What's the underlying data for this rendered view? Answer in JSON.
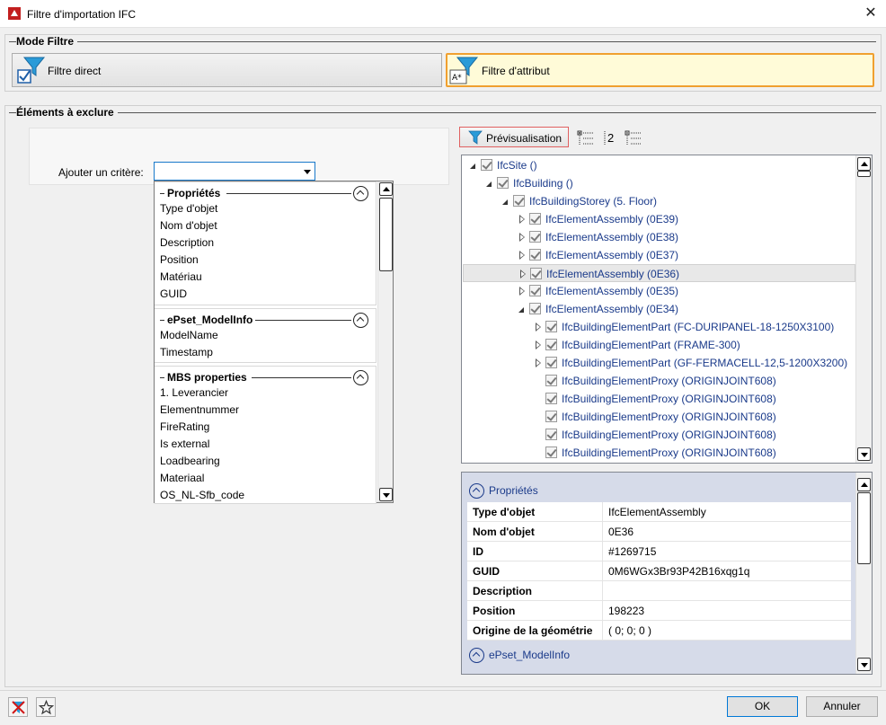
{
  "window": {
    "title": "Filtre d'importation IFC"
  },
  "mode_section": {
    "title": "Mode Filtre",
    "buttons": [
      {
        "label": "Filtre direct",
        "icon": "funnel-checkbox-icon",
        "active": false
      },
      {
        "label": "Filtre d'attribut",
        "icon": "funnel-text-icon",
        "active": true
      }
    ]
  },
  "exclude_section": {
    "title": "Éléments à exclure"
  },
  "criteria": {
    "label": "Ajouter un critère:",
    "value": "",
    "groups": [
      {
        "title": "Propriétés",
        "items": [
          "Type d'objet",
          "Nom d'objet",
          "Description",
          "Position",
          "Matériau",
          "GUID"
        ]
      },
      {
        "title": "ePset_ModelInfo",
        "items": [
          "ModelName",
          "Timestamp"
        ]
      },
      {
        "title": "MBS properties",
        "items": [
          "1. Leverancier",
          "Elementnummer",
          "FireRating",
          "Is external",
          "Loadbearing",
          "Materiaal",
          "OS_NL-Sfb_code"
        ]
      }
    ]
  },
  "toolbar": {
    "preview_label": "Prévisualisation",
    "count_label": "2"
  },
  "tree": {
    "nodes": [
      {
        "label": "IfcSite ()",
        "level": 0,
        "expander": "open",
        "selected": false
      },
      {
        "label": "IfcBuilding ()",
        "level": 1,
        "expander": "open",
        "selected": false
      },
      {
        "label": "IfcBuildingStorey (5. Floor)",
        "level": 2,
        "expander": "open",
        "selected": false
      },
      {
        "label": "IfcElementAssembly (0E39)",
        "level": 3,
        "expander": "closed",
        "selected": false
      },
      {
        "label": "IfcElementAssembly (0E38)",
        "level": 3,
        "expander": "closed",
        "selected": false
      },
      {
        "label": "IfcElementAssembly (0E37)",
        "level": 3,
        "expander": "closed",
        "selected": false
      },
      {
        "label": "IfcElementAssembly (0E36)",
        "level": 3,
        "expander": "closed",
        "selected": true
      },
      {
        "label": "IfcElementAssembly (0E35)",
        "level": 3,
        "expander": "closed",
        "selected": false
      },
      {
        "label": "IfcElementAssembly (0E34)",
        "level": 3,
        "expander": "open",
        "selected": false
      },
      {
        "label": "IfcBuildingElementPart (FC-DURIPANEL-18-1250X3100)",
        "level": 4,
        "expander": "closed",
        "selected": false
      },
      {
        "label": "IfcBuildingElementPart (FRAME-300)",
        "level": 4,
        "expander": "closed",
        "selected": false
      },
      {
        "label": "IfcBuildingElementPart (GF-FERMACELL-12,5-1200X3200)",
        "level": 4,
        "expander": "closed",
        "selected": false
      },
      {
        "label": "IfcBuildingElementProxy (ORIGINJOINT608)",
        "level": 4,
        "expander": "none",
        "selected": false
      },
      {
        "label": "IfcBuildingElementProxy (ORIGINJOINT608)",
        "level": 4,
        "expander": "none",
        "selected": false
      },
      {
        "label": "IfcBuildingElementProxy (ORIGINJOINT608)",
        "level": 4,
        "expander": "none",
        "selected": false
      },
      {
        "label": "IfcBuildingElementProxy (ORIGINJOINT608)",
        "level": 4,
        "expander": "none",
        "selected": false
      },
      {
        "label": "IfcBuildingElementProxy (ORIGINJOINT608)",
        "level": 4,
        "expander": "none",
        "selected": false
      }
    ]
  },
  "properties": {
    "category": "Propriétés",
    "rows": [
      {
        "key": "Type d'objet",
        "value": "IfcElementAssembly"
      },
      {
        "key": "Nom d'objet",
        "value": "0E36"
      },
      {
        "key": "ID",
        "value": "#1269715"
      },
      {
        "key": "GUID",
        "value": "0M6WGx3Br93P42B16xqg1q"
      },
      {
        "key": "Description",
        "value": ""
      },
      {
        "key": "Position",
        "value": "198223"
      },
      {
        "key": "Origine de la géométrie",
        "value": "( 0; 0; 0 )"
      }
    ],
    "next_category": "ePset_ModelInfo"
  },
  "footer": {
    "ok_label": "OK",
    "cancel_label": "Annuler"
  }
}
